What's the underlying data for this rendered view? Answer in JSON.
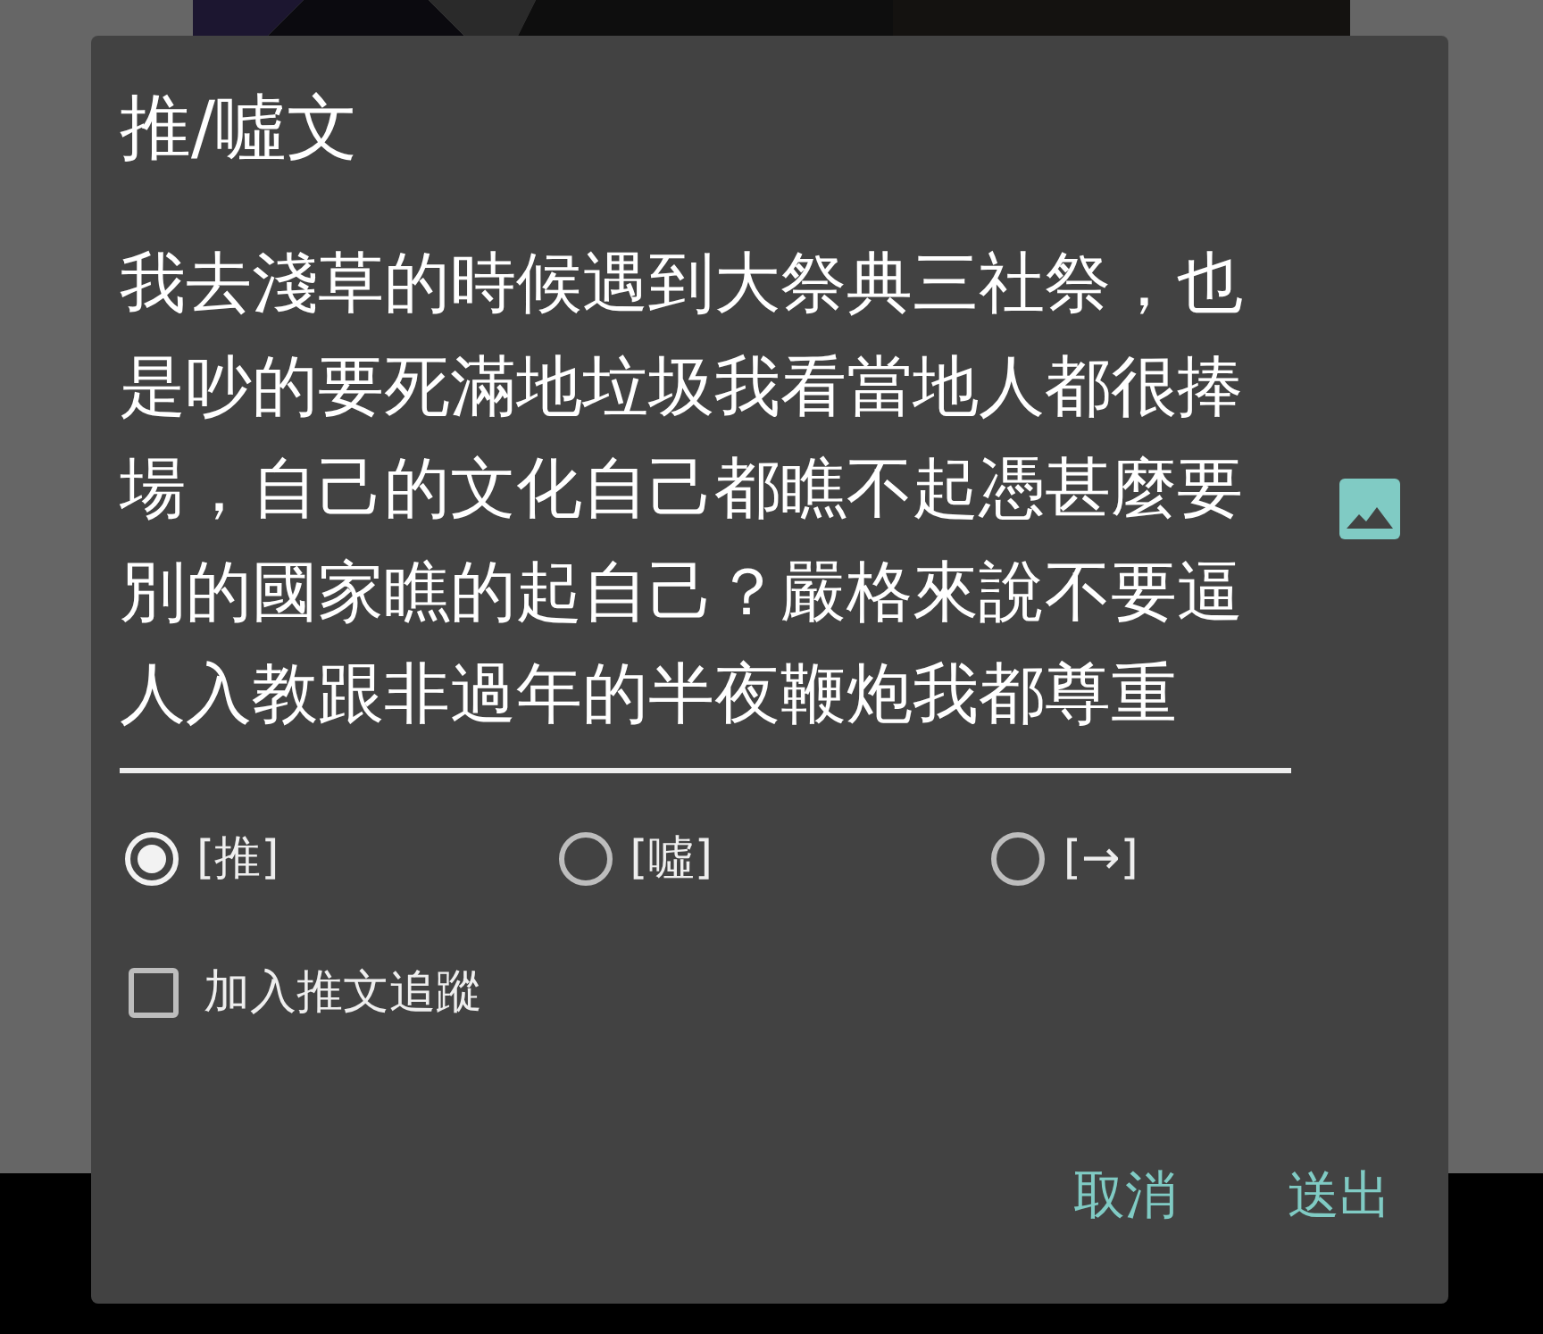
{
  "dialog": {
    "title": "推/噓文",
    "message": {
      "value": "我去淺草的時候遇到大祭典三社祭，也是吵的要死滿地垃圾我看當地人都很捧場，自己的文化自己都瞧不起憑甚麼要別的國家瞧的起自己？嚴格來說不要逼人入教跟非過年的半夜鞭炮我都尊重"
    },
    "options": [
      {
        "label": "[推]",
        "selected": true
      },
      {
        "label": "[噓]",
        "selected": false
      },
      {
        "label": "[→]",
        "selected": false
      }
    ],
    "follow": {
      "label": "加入推文追蹤",
      "checked": false
    },
    "buttons": [
      "取消",
      "送出"
    ]
  }
}
